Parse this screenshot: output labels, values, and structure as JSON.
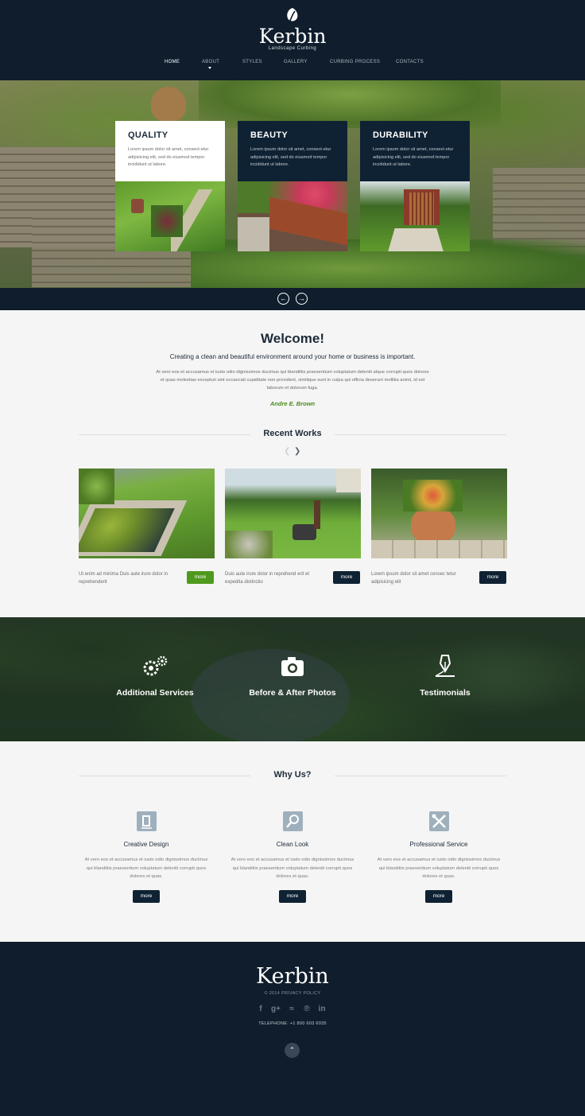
{
  "brand": {
    "name": "Kerbin",
    "tagline": "Landscape Curbing",
    "leaf_icon": "leaf-icon"
  },
  "nav": [
    {
      "label": "HOME",
      "active": true
    },
    {
      "label": "ABOUT",
      "active": false
    },
    {
      "label": "STYLES",
      "active": false
    },
    {
      "label": "GALLERY",
      "active": false
    },
    {
      "label": "CURBING PROCESS",
      "active": false
    },
    {
      "label": "CONTACTS",
      "active": false
    }
  ],
  "hero": {
    "cards": [
      {
        "title": "QUALITY",
        "text": "Lorem ipsum dolor sit amet, consect-etur adipisicing elit, sed do eiusmod tempor incididunt ut labore."
      },
      {
        "title": "BEAUTY",
        "text": "Lorem ipsum dolor sit amet, consect-etur adipisicing elit, sed do eiusmod tempor incididunt ut labore."
      },
      {
        "title": "DURABILITY",
        "text": "Lorem ipsum dolor sit amet, consect-etur adipisicing elit, sed do eiusmod tempor incididunt ut labore."
      }
    ],
    "prev_icon": "arrow-left-icon",
    "next_icon": "arrow-right-icon"
  },
  "welcome": {
    "title": "Welcome!",
    "subtitle": "Creating a clean and beautiful environment around your home or business is important.",
    "body": "At vero eos et accusamus et iusto odio dignissimos ducimus qui blanditiis praesentium voluptatum deleniti atque corrupti quos dolores et quas molestias excepturi sint occaecati cupiditate non provident, similique sunt in culpa qui officia deserunt mollitia animi, id est laborum et dolorum fuga.",
    "signature": "Andre E. Brown"
  },
  "recent_works": {
    "title": "Recent Works",
    "items": [
      {
        "text": "Ut enim ad minima Duis aute irure dolor in reprehenderit",
        "button": "more"
      },
      {
        "text": "Duis aute irure dolor in reprehend erit et expedita distinctio",
        "button": "more"
      },
      {
        "text": "Lorem ipsum dolor sit amet consec tetur adipisicing elit",
        "button": "more"
      }
    ]
  },
  "services": [
    {
      "label": "Additional Services",
      "icon": "gears-icon"
    },
    {
      "label": "Before & After Photos",
      "icon": "camera-icon"
    },
    {
      "label": "Testimonials",
      "icon": "pen-nib-icon"
    }
  ],
  "why_us": {
    "title": "Why Us?",
    "items": [
      {
        "title": "Creative Design",
        "icon": "document-icon",
        "text": "At vero eos et accusamus et iusto odio dignissimos ducimus qui blanditiis praesentium voluptatum deleniti corrupti quos dolores et quas.",
        "button": "more"
      },
      {
        "title": "Clean Look",
        "icon": "magnifier-icon",
        "text": "At vero eos et accusamus et iusto odio dignissimos ducimus qui blanditiis praesentium voluptatum deleniti corrupti quos dolores et quas.",
        "button": "more"
      },
      {
        "title": "Professional Service",
        "icon": "tools-icon",
        "text": "At vero eos et accusamus et iusto odio dignissimos ducimus qui blanditiis praesentium voluptatum deleniti corrupti quos dolores et quas.",
        "button": "more"
      }
    ]
  },
  "footer": {
    "logo": "Kerbin",
    "copyright": "© 2014  PRIVACY POLICY",
    "social": [
      {
        "icon": "facebook-icon",
        "glyph": "f"
      },
      {
        "icon": "google-plus-icon",
        "glyph": "g+"
      },
      {
        "icon": "rss-icon",
        "glyph": "≈"
      },
      {
        "icon": "pinterest-icon",
        "glyph": "℗"
      },
      {
        "icon": "linkedin-icon",
        "glyph": "in"
      }
    ],
    "phone": "TELEPHONE:  +1 800 603 6035",
    "top_icon": "chevron-up-icon"
  },
  "colors": {
    "navy": "#0f1d2c",
    "card_dark": "#0f2233",
    "green": "#4f9a1d",
    "icon_gray": "#9fb0bd"
  }
}
